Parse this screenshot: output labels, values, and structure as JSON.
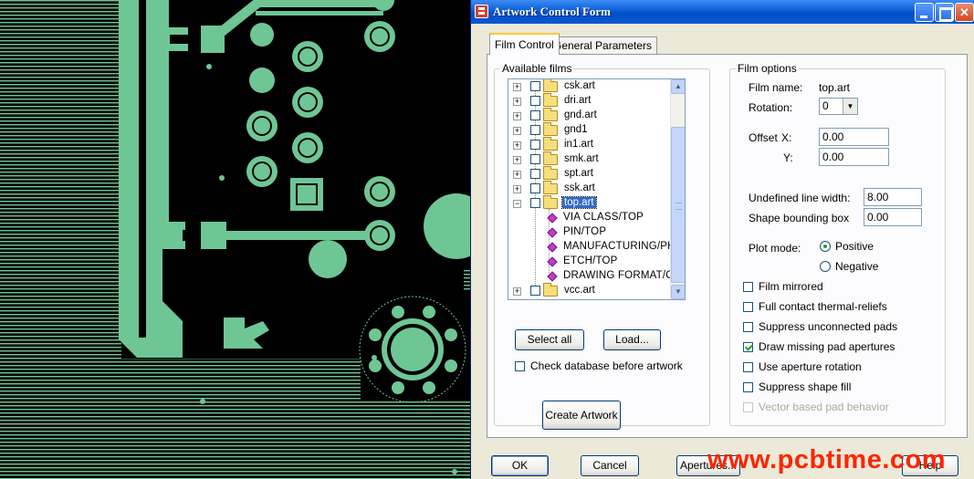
{
  "window": {
    "title": "Artwork Control Form",
    "title_bar_color": "#0a5fd8"
  },
  "tabs": [
    {
      "label": "Film Control",
      "active": true
    },
    {
      "label": "General Parameters",
      "active": false
    }
  ],
  "available_films": {
    "group_label": "Available films",
    "items": [
      {
        "label": "csk.art",
        "expanded": false,
        "checked": false
      },
      {
        "label": "dri.art",
        "expanded": false,
        "checked": false
      },
      {
        "label": "gnd.art",
        "expanded": false,
        "checked": false
      },
      {
        "label": "gnd1",
        "expanded": false,
        "checked": false
      },
      {
        "label": "in1.art",
        "expanded": false,
        "checked": false
      },
      {
        "label": "smk.art",
        "expanded": false,
        "checked": false
      },
      {
        "label": "spt.art",
        "expanded": false,
        "checked": false
      },
      {
        "label": "ssk.art",
        "expanded": false,
        "checked": false
      },
      {
        "label": "top.art",
        "expanded": true,
        "checked": false,
        "selected": true
      },
      {
        "label": "vcc.art",
        "expanded": false,
        "checked": false
      }
    ],
    "subclasses": [
      {
        "label": "VIA CLASS/TOP"
      },
      {
        "label": "PIN/TOP"
      },
      {
        "label": "MANUFACTURING/PH"
      },
      {
        "label": "ETCH/TOP"
      },
      {
        "label": "DRAWING FORMAT/O"
      }
    ],
    "select_all_label": "Select all",
    "load_label": "Load...",
    "check_database_label": "Check database before artwork",
    "check_database_checked": false,
    "create_artwork_label": "Create Artwork"
  },
  "film_options": {
    "group_label": "Film options",
    "film_name_label": "Film name:",
    "film_name_value": "top.art",
    "rotation_label": "Rotation:",
    "rotation_value": "0",
    "offset_label": "Offset",
    "offset_x_label": "X:",
    "offset_x_value": "0.00",
    "offset_y_label": "Y:",
    "offset_y_value": "0.00",
    "undefined_line_width_label": "Undefined line width:",
    "undefined_line_width_value": "8.00",
    "shape_bounding_box_label": "Shape bounding box",
    "shape_bounding_box_value": "0.00",
    "plot_mode_label": "Plot mode:",
    "plot_mode_positive_label": "Positive",
    "plot_mode_negative_label": "Negative",
    "plot_mode_selected": "Positive",
    "checkboxes": [
      {
        "label": "Film mirrored",
        "checked": false,
        "enabled": true
      },
      {
        "label": "Full contact thermal-reliefs",
        "checked": false,
        "enabled": true
      },
      {
        "label": "Suppress unconnected pads",
        "checked": false,
        "enabled": true
      },
      {
        "label": "Draw missing pad apertures",
        "checked": true,
        "enabled": true
      },
      {
        "label": "Use aperture rotation",
        "checked": false,
        "enabled": true
      },
      {
        "label": "Suppress shape fill",
        "checked": false,
        "enabled": true
      },
      {
        "label": "Vector based pad behavior",
        "checked": false,
        "enabled": false
      }
    ]
  },
  "footer": {
    "ok_label": "OK",
    "cancel_label": "Cancel",
    "apertures_label": "Apertures...",
    "help_label": "Help"
  },
  "watermark": "www.pcbtime.com",
  "colors": {
    "pcb_copper": "#6fc695",
    "pcb_background": "#000000",
    "watermark": "#ff2400"
  }
}
